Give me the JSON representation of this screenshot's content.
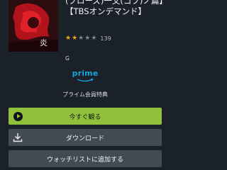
{
  "title": "(ブローズ)一文(コブ)ノ篇】【TBSオンデマンド】",
  "rating": {
    "stars_filled": 2,
    "stars_total": 5,
    "count": "139"
  },
  "age_rating": "G",
  "prime": {
    "logo_text": "prime",
    "benefit_text": "プライム会員特典"
  },
  "buttons": {
    "watch_now": "今すぐ観る",
    "download": "ダウンロード",
    "add_watchlist": "ウォッチリストに追加する"
  },
  "poster": {
    "kanji": "炎"
  },
  "colors": {
    "background": "#1a2129",
    "accent_green": "#8fc13c",
    "button_gray": "#424b54",
    "prime_blue": "#1aa1d6",
    "star_gold": "#f0a81f"
  }
}
